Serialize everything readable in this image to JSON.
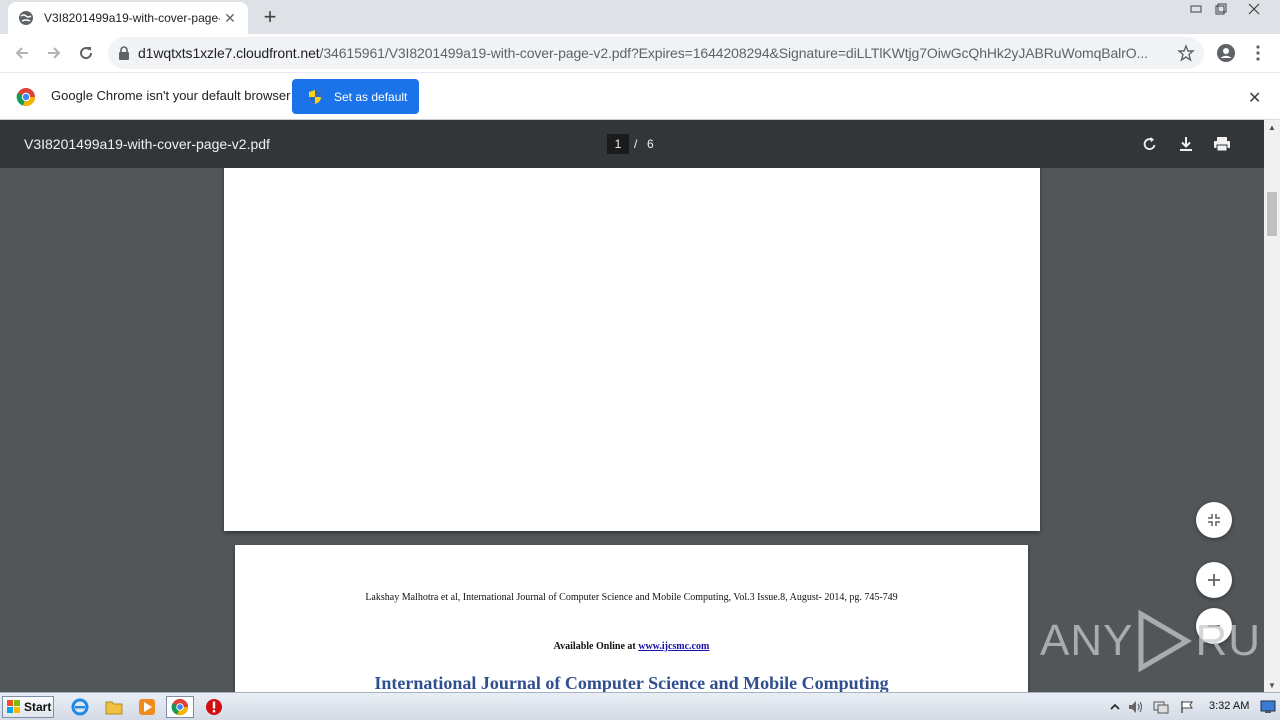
{
  "browser": {
    "tab_title": "V3I8201499a19-with-cover-page-v2.pdf",
    "url_host": "d1wqtxts1xzle7.cloudfront.net",
    "url_path": "/34615961/V3I8201499a19-with-cover-page-v2.pdf?Expires=1644208294&Signature=diLLTlKWtjg7OiwGcQhHk2yJABRuWomqBalrO..."
  },
  "infobar": {
    "message": "Google Chrome isn't your default browser",
    "button_label": "Set as default"
  },
  "pdf": {
    "filename": "V3I8201499a19-with-cover-page-v2.pdf",
    "current_page": "1",
    "separator": "/",
    "total_pages": "6"
  },
  "page2": {
    "citation": "Lakshay Malhotra et al, International Journal of Computer Science and Mobile Computing, Vol.3 Issue.8, August- 2014, pg. 745-749",
    "available_prefix": "Available Online at ",
    "available_link": "www.ijcsmc.com",
    "journal_title": "International Journal of Computer Science and Mobile Computing"
  },
  "watermark": {
    "text_left": "ANY",
    "text_right": "RUN"
  },
  "taskbar": {
    "start_label": "Start",
    "clock": "3:32 AM"
  },
  "colors": {
    "accent": "#1a73e8",
    "pdf_toolbar": "#323639",
    "viewer_bg": "#525659",
    "journal_title": "#2f4f8f"
  }
}
